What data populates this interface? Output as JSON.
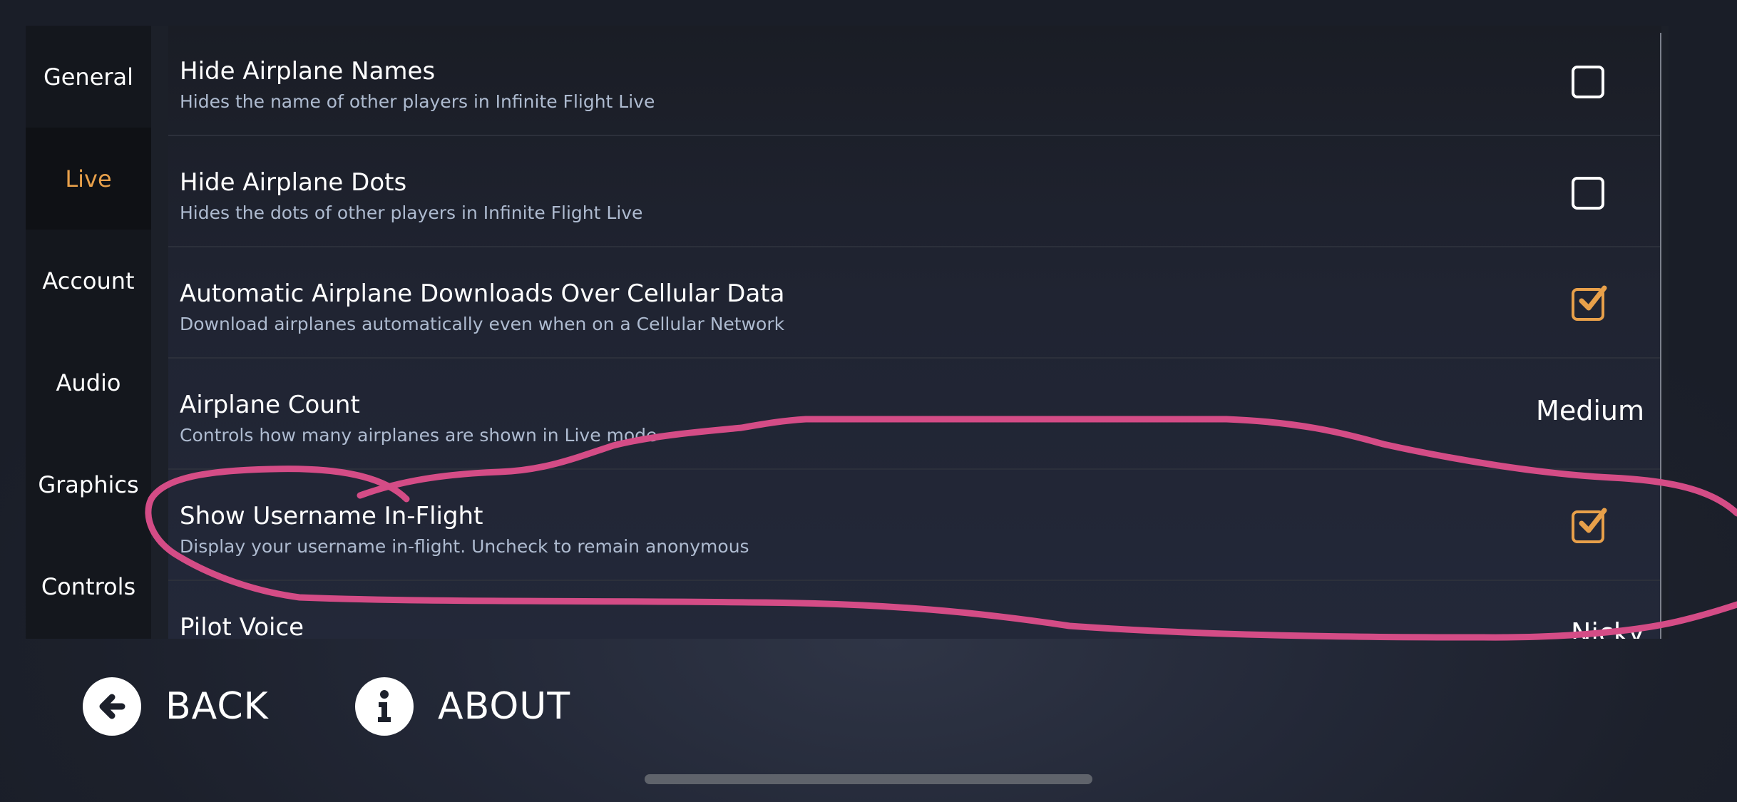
{
  "colors": {
    "accent": "#e8a04a",
    "annotation": "#d44c86",
    "background": "#1c202b"
  },
  "sidebar": {
    "items": [
      {
        "label": "General",
        "active": false
      },
      {
        "label": "Live",
        "active": true
      },
      {
        "label": "Account",
        "active": false
      },
      {
        "label": "Audio",
        "active": false
      },
      {
        "label": "Graphics",
        "active": false
      },
      {
        "label": "Controls",
        "active": false
      }
    ]
  },
  "settings": [
    {
      "title": "Hide Airplane Names",
      "description": "Hides the name of other players in Infinite Flight Live",
      "control": "checkbox",
      "checked": false
    },
    {
      "title": "Hide Airplane Dots",
      "description": "Hides the dots of other players in Infinite Flight Live",
      "control": "checkbox",
      "checked": false
    },
    {
      "title": "Automatic Airplane Downloads Over Cellular Data",
      "description": "Download airplanes automatically even when on a Cellular Network",
      "control": "checkbox",
      "checked": true
    },
    {
      "title": "Airplane Count",
      "description": "Controls how many airplanes are shown in Live mode",
      "control": "value",
      "value": "Medium"
    },
    {
      "title": "Show Username In-Flight",
      "description": "Display your username in-flight. Uncheck to remain anonymous",
      "control": "checkbox",
      "checked": true
    },
    {
      "title": "Pilot Voice",
      "description": "",
      "control": "value",
      "value": "Nicky"
    }
  ],
  "footer": {
    "back_label": "BACK",
    "back_icon": "arrow-left-circle-icon",
    "about_label": "ABOUT",
    "about_icon": "info-circle-icon"
  }
}
